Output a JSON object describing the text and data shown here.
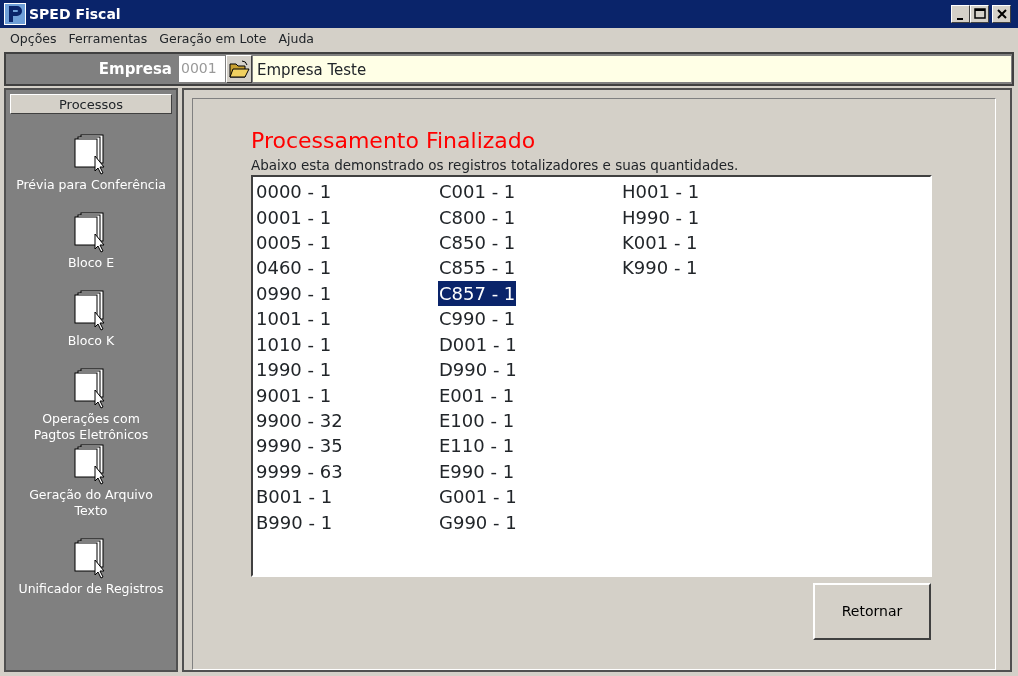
{
  "window": {
    "title": "SPED Fiscal"
  },
  "menu": [
    "Opções",
    "Ferramentas",
    "Geração em Lote",
    "Ajuda"
  ],
  "empresa": {
    "label": "Empresa",
    "code": "0001",
    "name": "Empresa Teste"
  },
  "sidebar": {
    "header": "Processos",
    "items": [
      {
        "label": "Prévia para Conferência"
      },
      {
        "label": "Bloco E"
      },
      {
        "label": "Bloco K"
      },
      {
        "label": "Operações com\nPagtos Eletrônicos"
      },
      {
        "label": "Geração do Arquivo Texto"
      },
      {
        "label": "Unificador de Registros"
      }
    ]
  },
  "result": {
    "title": "Processamento Finalizado",
    "subtitle": "Abaixo esta demonstrado os registros totalizadores e suas quantidades.",
    "columns": [
      [
        {
          "text": "0000 - 1",
          "selected": false
        },
        {
          "text": "0001 - 1",
          "selected": false
        },
        {
          "text": "0005 - 1",
          "selected": false
        },
        {
          "text": "0460 - 1",
          "selected": false
        },
        {
          "text": "0990 - 1",
          "selected": false
        },
        {
          "text": "1001 - 1",
          "selected": false
        },
        {
          "text": "1010 - 1",
          "selected": false
        },
        {
          "text": "1990 - 1",
          "selected": false
        },
        {
          "text": "9001 - 1",
          "selected": false
        },
        {
          "text": "9900 - 32",
          "selected": false
        },
        {
          "text": "9990 - 35",
          "selected": false
        },
        {
          "text": "9999 - 63",
          "selected": false
        },
        {
          "text": "B001 - 1",
          "selected": false
        },
        {
          "text": "B990 - 1",
          "selected": false
        }
      ],
      [
        {
          "text": "C001 - 1",
          "selected": false
        },
        {
          "text": "C800 - 1",
          "selected": false
        },
        {
          "text": "C850 - 1",
          "selected": false
        },
        {
          "text": "C855 - 1",
          "selected": false
        },
        {
          "text": "C857 - 1",
          "selected": true
        },
        {
          "text": "C990 - 1",
          "selected": false
        },
        {
          "text": "D001 - 1",
          "selected": false
        },
        {
          "text": "D990 - 1",
          "selected": false
        },
        {
          "text": "E001 - 1",
          "selected": false
        },
        {
          "text": "E100 - 1",
          "selected": false
        },
        {
          "text": "E110 - 1",
          "selected": false
        },
        {
          "text": "E990 - 1",
          "selected": false
        },
        {
          "text": "G001 - 1",
          "selected": false
        },
        {
          "text": "G990 - 1",
          "selected": false
        }
      ],
      [
        {
          "text": "H001 - 1",
          "selected": false
        },
        {
          "text": "H990 - 1",
          "selected": false
        },
        {
          "text": "K001 - 1",
          "selected": false
        },
        {
          "text": "K990 - 1",
          "selected": false
        }
      ]
    ],
    "button": "Retornar"
  }
}
